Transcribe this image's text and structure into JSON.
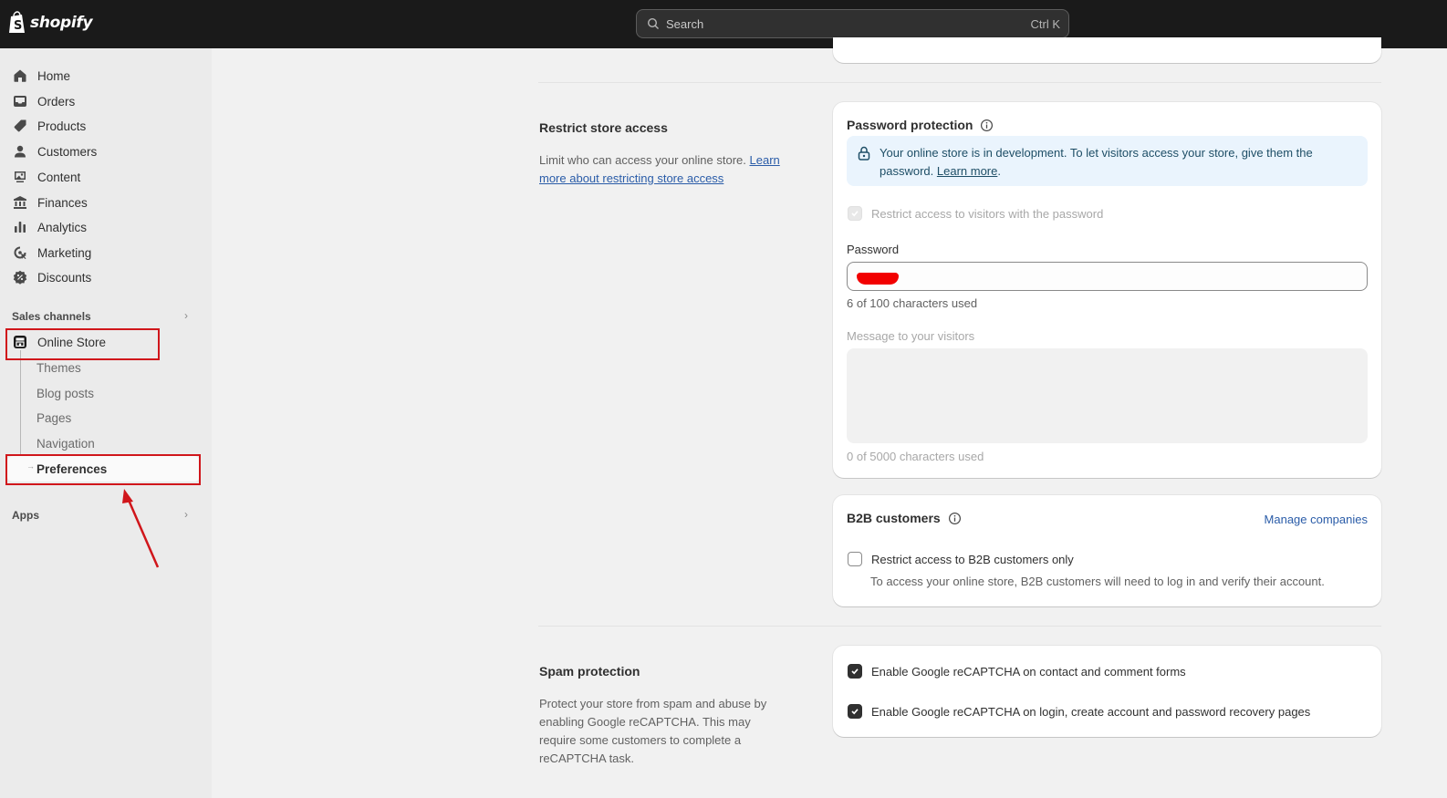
{
  "topbar": {
    "brand": "shopify",
    "search": {
      "placeholder": "Search",
      "shortcut": "Ctrl K"
    }
  },
  "sidebar": {
    "items": [
      {
        "label": "Home",
        "icon": "home-icon"
      },
      {
        "label": "Orders",
        "icon": "inbox-icon"
      },
      {
        "label": "Products",
        "icon": "tag-icon"
      },
      {
        "label": "Customers",
        "icon": "person-icon"
      },
      {
        "label": "Content",
        "icon": "image-icon"
      },
      {
        "label": "Finances",
        "icon": "bank-icon"
      },
      {
        "label": "Analytics",
        "icon": "bar-chart-icon"
      },
      {
        "label": "Marketing",
        "icon": "target-icon"
      },
      {
        "label": "Discounts",
        "icon": "discount-icon"
      }
    ],
    "sales_channels": {
      "title": "Sales channels",
      "online_store": {
        "label": "Online Store",
        "icon": "store-icon"
      },
      "sub_items": [
        "Themes",
        "Blog posts",
        "Pages",
        "Navigation",
        "Preferences"
      ],
      "selected": "Preferences"
    },
    "apps": {
      "title": "Apps"
    }
  },
  "annotations": {
    "highlight_color": "#d0161b",
    "highlighted": [
      "Online Store",
      "Preferences"
    ]
  },
  "restrict_access": {
    "title": "Restrict store access",
    "description": "Limit who can access your online store. ",
    "link": "Learn more about restricting store access",
    "password_card": {
      "title": "Password protection",
      "banner_text": "Your online store is in development. To let visitors access your store, give them the password. ",
      "banner_link": "Learn more",
      "banner_suffix": ".",
      "restrict_checkbox": {
        "label": "Restrict access to visitors with the password",
        "checked": true,
        "disabled": true
      },
      "password_label": "Password",
      "password_value": "[redacted]",
      "password_help": "6 of 100 characters used",
      "message_label": "Message to your visitors",
      "message_value": "",
      "message_help": "0 of 5000 characters used"
    },
    "b2b_card": {
      "title": "B2B customers",
      "action": "Manage companies",
      "checkbox": {
        "label": "Restrict access to B2B customers only",
        "checked": false
      },
      "help": "To access your online store, B2B customers will need to log in and verify their account."
    }
  },
  "spam_protection": {
    "title": "Spam protection",
    "description": "Protect your store from spam and abuse by enabling Google reCAPTCHA. This may require some customers to complete a reCAPTCHA task.",
    "options": [
      {
        "label": "Enable Google reCAPTCHA on contact and comment forms",
        "checked": true
      },
      {
        "label": "Enable Google reCAPTCHA on login, create account and password recovery pages",
        "checked": true
      }
    ]
  }
}
